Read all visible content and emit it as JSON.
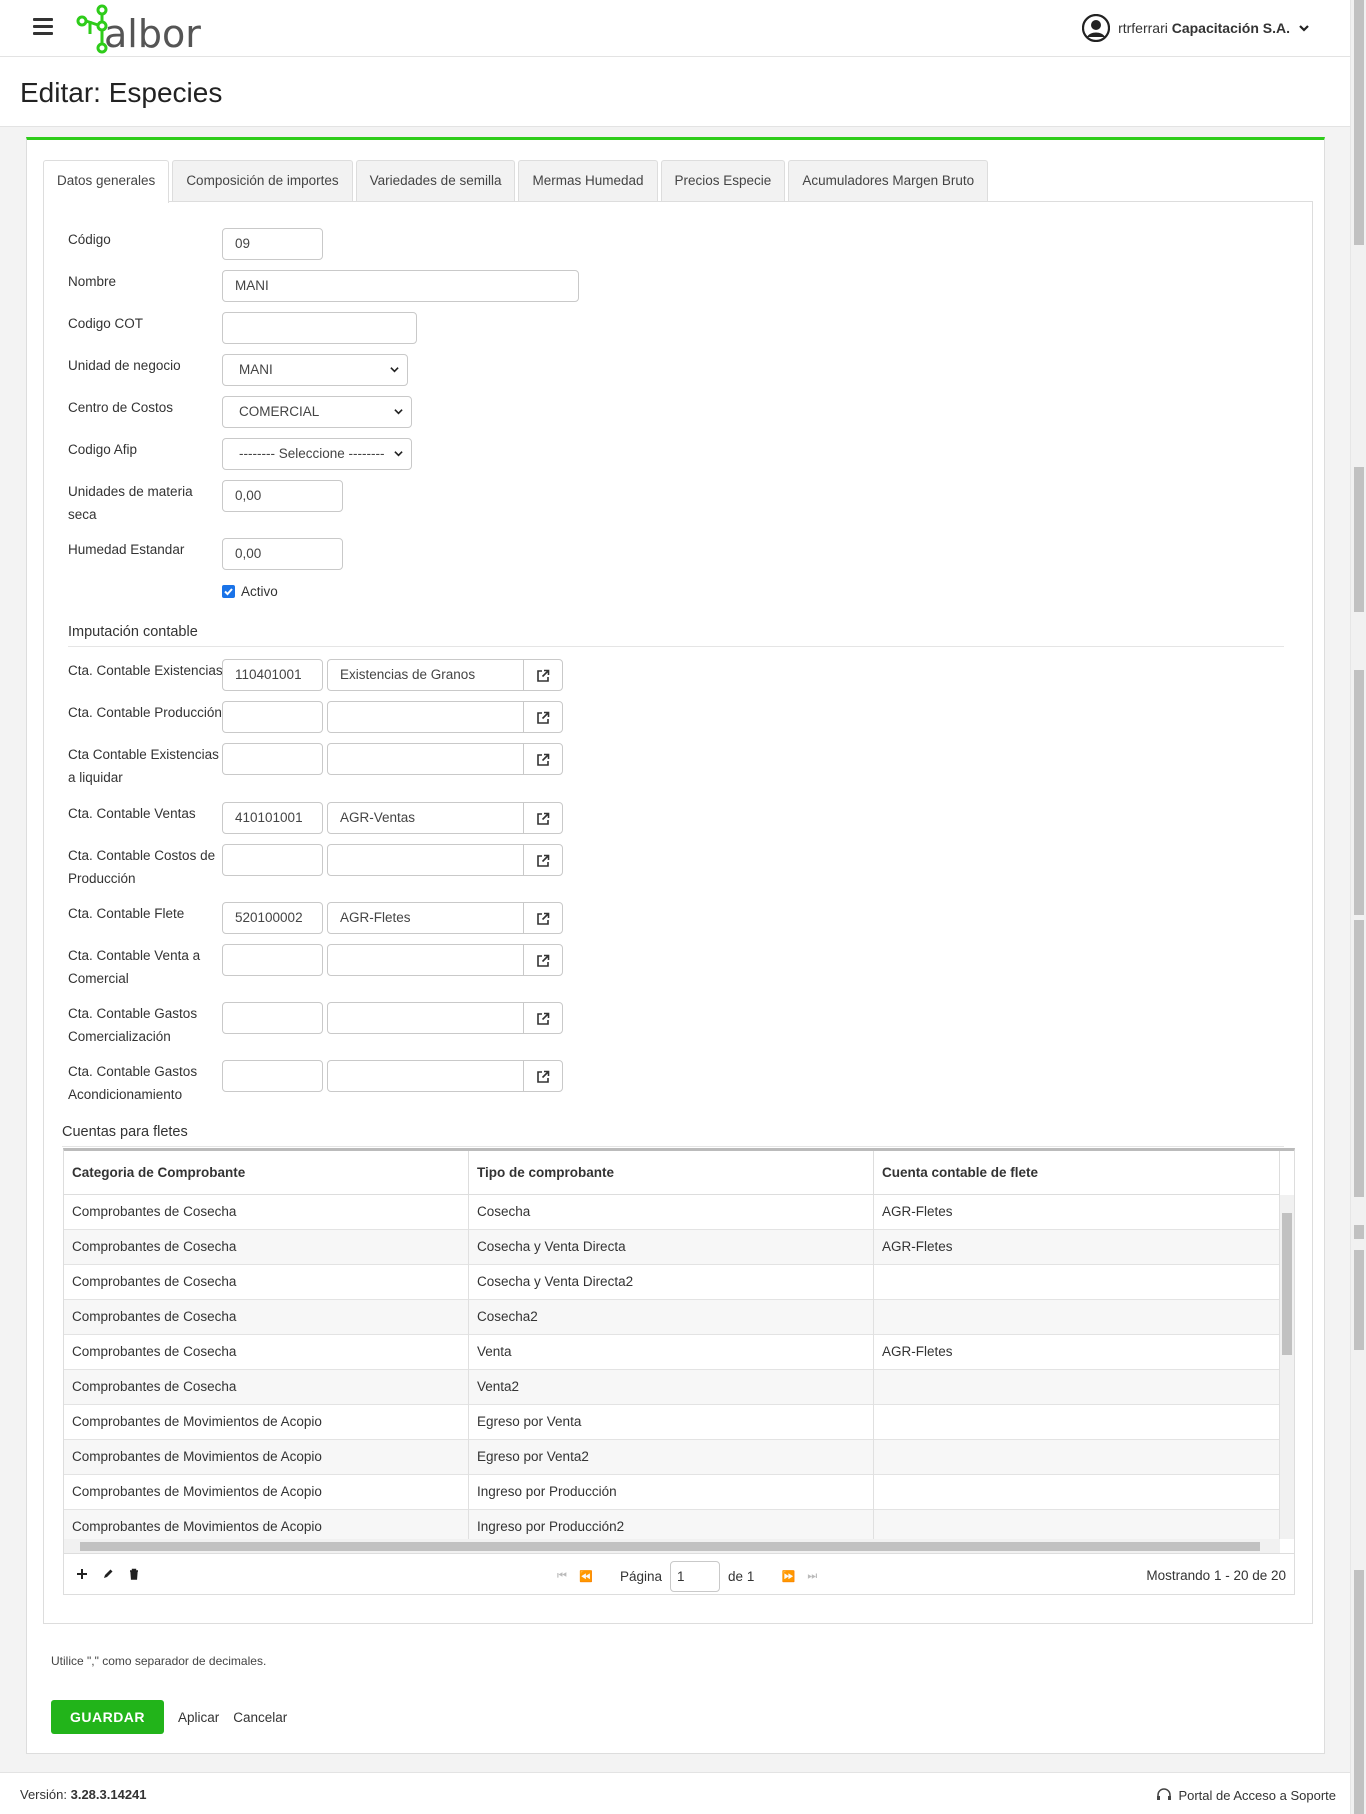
{
  "app": {
    "logo_text": "albor",
    "user_name": "rtrferrari",
    "company": "Capacitación S.A.",
    "accent_color": "#2ecc1a"
  },
  "page": {
    "title": "Editar: Especies"
  },
  "tabs": [
    {
      "label": "Datos generales",
      "active": true
    },
    {
      "label": "Composición de importes"
    },
    {
      "label": "Variedades de semilla"
    },
    {
      "label": "Mermas Humedad"
    },
    {
      "label": "Precios Especie"
    },
    {
      "label": "Acumuladores Margen Bruto"
    }
  ],
  "form": {
    "codigo": {
      "label": "Código",
      "value": "09"
    },
    "nombre": {
      "label": "Nombre",
      "value": "MANI"
    },
    "codigo_cot": {
      "label": "Codigo COT",
      "value": ""
    },
    "unidad_negocio": {
      "label": "Unidad de negocio",
      "value": "MANI"
    },
    "centro_costos": {
      "label": "Centro de Costos",
      "value": "COMERCIAL"
    },
    "codigo_afip": {
      "label": "Codigo Afip",
      "value": "-------- Seleccione --------"
    },
    "unidades_materia_seca": {
      "label_1": "Unidades de materia",
      "label_2": "seca",
      "value": "0,00"
    },
    "humedad_estandar": {
      "label": "Humedad Estandar",
      "value": "0,00"
    },
    "activo": {
      "label": "Activo",
      "checked": true
    }
  },
  "imputacion": {
    "title": "Imputación contable",
    "rows": [
      {
        "label_1": "Cta. Contable Existencias",
        "label_2": "",
        "code": "110401001",
        "name": "Existencias de Granos"
      },
      {
        "label_1": "Cta. Contable Producción",
        "label_2": "",
        "code": "",
        "name": ""
      },
      {
        "label_1": "Cta Contable Existencias",
        "label_2": "a liquidar",
        "code": "",
        "name": ""
      },
      {
        "label_1": "Cta. Contable Ventas",
        "label_2": "",
        "code": "410101001",
        "name": "AGR-Ventas"
      },
      {
        "label_1": "Cta. Contable Costos de",
        "label_2": "Producción",
        "code": "",
        "name": ""
      },
      {
        "label_1": "Cta. Contable Flete",
        "label_2": "",
        "code": "520100002",
        "name": "AGR-Fletes"
      },
      {
        "label_1": "Cta. Contable Venta a",
        "label_2": "Comercial",
        "code": "",
        "name": ""
      },
      {
        "label_1": "Cta. Contable Gastos",
        "label_2": "Comercialización",
        "code": "",
        "name": ""
      },
      {
        "label_1": "Cta. Contable Gastos",
        "label_2": "Acondicionamiento",
        "code": "",
        "name": ""
      }
    ]
  },
  "fletes": {
    "title": "Cuentas para fletes",
    "columns": [
      "Categoria de Comprobante",
      "Tipo de comprobante",
      "Cuenta contable de flete"
    ],
    "rows": [
      [
        "Comprobantes de Cosecha",
        "Cosecha",
        "AGR-Fletes"
      ],
      [
        "Comprobantes de Cosecha",
        "Cosecha y Venta Directa",
        "AGR-Fletes"
      ],
      [
        "Comprobantes de Cosecha",
        "Cosecha y Venta Directa2",
        ""
      ],
      [
        "Comprobantes de Cosecha",
        "Cosecha2",
        ""
      ],
      [
        "Comprobantes de Cosecha",
        "Venta",
        "AGR-Fletes"
      ],
      [
        "Comprobantes de Cosecha",
        "Venta2",
        ""
      ],
      [
        "Comprobantes de Movimientos de Acopio",
        "Egreso por Venta",
        ""
      ],
      [
        "Comprobantes de Movimientos de Acopio",
        "Egreso por Venta2",
        ""
      ],
      [
        "Comprobantes de Movimientos de Acopio",
        "Ingreso por Producción",
        ""
      ],
      [
        "Comprobantes de Movimientos de Acopio",
        "Ingreso por Producción2",
        ""
      ]
    ],
    "pager": {
      "page_label": "Página",
      "page_value": "1",
      "of_label": "de 1",
      "summary": "Mostrando 1 - 20 de 20"
    }
  },
  "note": "Utilice \",\" como separador de decimales.",
  "actions": {
    "save": "GUARDAR",
    "apply": "Aplicar",
    "cancel": "Cancelar"
  },
  "footer": {
    "version_label": "Versión:",
    "version": "3.28.3.14241",
    "support": "Portal de Acceso a Soporte"
  }
}
